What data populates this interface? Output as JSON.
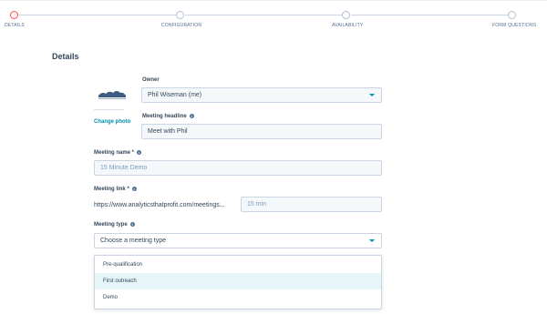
{
  "stepper": {
    "steps": [
      {
        "label": "DETAILS",
        "active": true
      },
      {
        "label": "CONFIGURATION",
        "active": false
      },
      {
        "label": "AVAILABILITY",
        "active": false
      },
      {
        "label": "FORM QUESTIONS",
        "active": false
      }
    ]
  },
  "section_title": "Details",
  "photo": {
    "change_label": "Change photo"
  },
  "owner": {
    "label": "Owner",
    "value": "Phil Wiseman (me)"
  },
  "headline": {
    "label": "Meeting headline",
    "value": "Meet with Phil"
  },
  "meeting_name": {
    "label": "Meeting name *",
    "placeholder": "15 Minute Demo"
  },
  "meeting_link": {
    "label": "Meeting link *",
    "prefix": "https://www.analyticsthatprofit.com/meetings...",
    "placeholder": "15 min"
  },
  "meeting_type": {
    "label": "Meeting type",
    "placeholder": "Choose a meeting type",
    "options": [
      "Pre-qualification",
      "First outreach",
      "Demo"
    ],
    "highlighted": "First outreach"
  },
  "colors": {
    "accent": "#0091ae",
    "active_step": "#f2545b",
    "text": "#33475b",
    "field_bg": "#f5f8fa"
  },
  "icons": {
    "info": "info-icon",
    "caret": "chevron-down-icon"
  }
}
